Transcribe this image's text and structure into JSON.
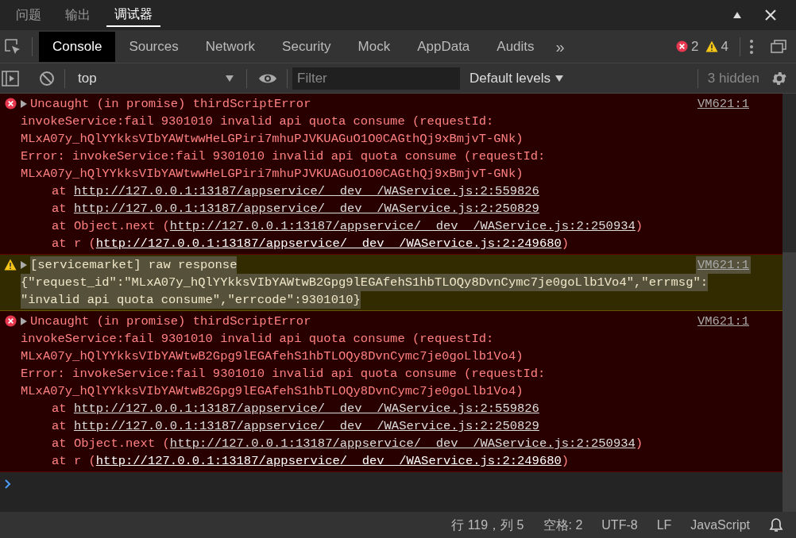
{
  "panel_tabs": [
    {
      "label": "问题",
      "selected": false
    },
    {
      "label": "输出",
      "selected": false
    },
    {
      "label": "调试器",
      "selected": true
    }
  ],
  "devtools_tabs": [
    {
      "label": "Console",
      "selected": true
    },
    {
      "label": "Sources",
      "selected": false
    },
    {
      "label": "Network",
      "selected": false
    },
    {
      "label": "Security",
      "selected": false
    },
    {
      "label": "Mock",
      "selected": false
    },
    {
      "label": "AppData",
      "selected": false
    },
    {
      "label": "Audits",
      "selected": false
    }
  ],
  "more_tabs": "»",
  "error_count": "2",
  "warning_count": "4",
  "toolbar": {
    "context": "top",
    "filter_placeholder": "Filter",
    "levels": "Default levels",
    "hidden": "3 hidden"
  },
  "entries": [
    {
      "kind": "error",
      "selected": false,
      "title": "Uncaught (in promise) thirdScriptError",
      "source": "VM621:1",
      "lines": [
        "invokeService:fail 9301010 invalid api quota consume (requestId:",
        "MLxA07y_hQlYYkksVIbYAWtwwHeLGPiri7mhuPJVKUAGuO1O0CAGthQj9xBmjvT-GNk)",
        "Error: invokeService:fail 9301010 invalid api quota consume (requestId:",
        "MLxA07y_hQlYYkksVIbYAWtwwHeLGPiri7mhuPJVKUAGuO1O0CAGthQj9xBmjvT-GNk)"
      ],
      "stack": [
        {
          "prefix": "at ",
          "url": "http://127.0.0.1:13187/appservice/__dev__/WAService.js:2:559826"
        },
        {
          "prefix": "at ",
          "url": "http://127.0.0.1:13187/appservice/__dev__/WAService.js:2:250829"
        },
        {
          "prefix": "at Object.next (",
          "url": "http://127.0.0.1:13187/appservice/__dev__/WAService.js:2:250934",
          "suffix": ")"
        },
        {
          "prefix": "at r (",
          "url": "http://127.0.0.1:13187/appservice/__dev__/WAService.js:2:249680",
          "suffix": ")"
        }
      ]
    },
    {
      "kind": "warning",
      "selected": true,
      "title": "[servicemarket] raw response",
      "source": "VM621:1",
      "lines": [
        "{\"request_id\":\"MLxA07y_hQlYYkksVIbYAWtwB2Gpg9lEGAfehS1hbTLOQy8DvnCymc7je0goLlb1Vo4\",\"errmsg\":",
        "\"invalid api quota consume\",\"errcode\":9301010}"
      ]
    },
    {
      "kind": "error",
      "selected": false,
      "title": "Uncaught (in promise) thirdScriptError",
      "source": "VM621:1",
      "lines": [
        "invokeService:fail 9301010 invalid api quota consume (requestId:",
        "MLxA07y_hQlYYkksVIbYAWtwB2Gpg9lEGAfehS1hbTLOQy8DvnCymc7je0goLlb1Vo4)",
        "Error: invokeService:fail 9301010 invalid api quota consume (requestId:",
        "MLxA07y_hQlYYkksVIbYAWtwB2Gpg9lEGAfehS1hbTLOQy8DvnCymc7je0goLlb1Vo4)"
      ],
      "stack": [
        {
          "prefix": "at ",
          "url": "http://127.0.0.1:13187/appservice/__dev__/WAService.js:2:559826"
        },
        {
          "prefix": "at ",
          "url": "http://127.0.0.1:13187/appservice/__dev__/WAService.js:2:250829"
        },
        {
          "prefix": "at Object.next (",
          "url": "http://127.0.0.1:13187/appservice/__dev__/WAService.js:2:250934",
          "suffix": ")"
        },
        {
          "prefix": "at r (",
          "url": "http://127.0.0.1:13187/appservice/__dev__/WAService.js:2:249680",
          "suffix": ")"
        }
      ]
    }
  ],
  "status_bar": [
    "行 119，列 5",
    "空格: 2",
    "UTF-8",
    "LF",
    "JavaScript"
  ]
}
